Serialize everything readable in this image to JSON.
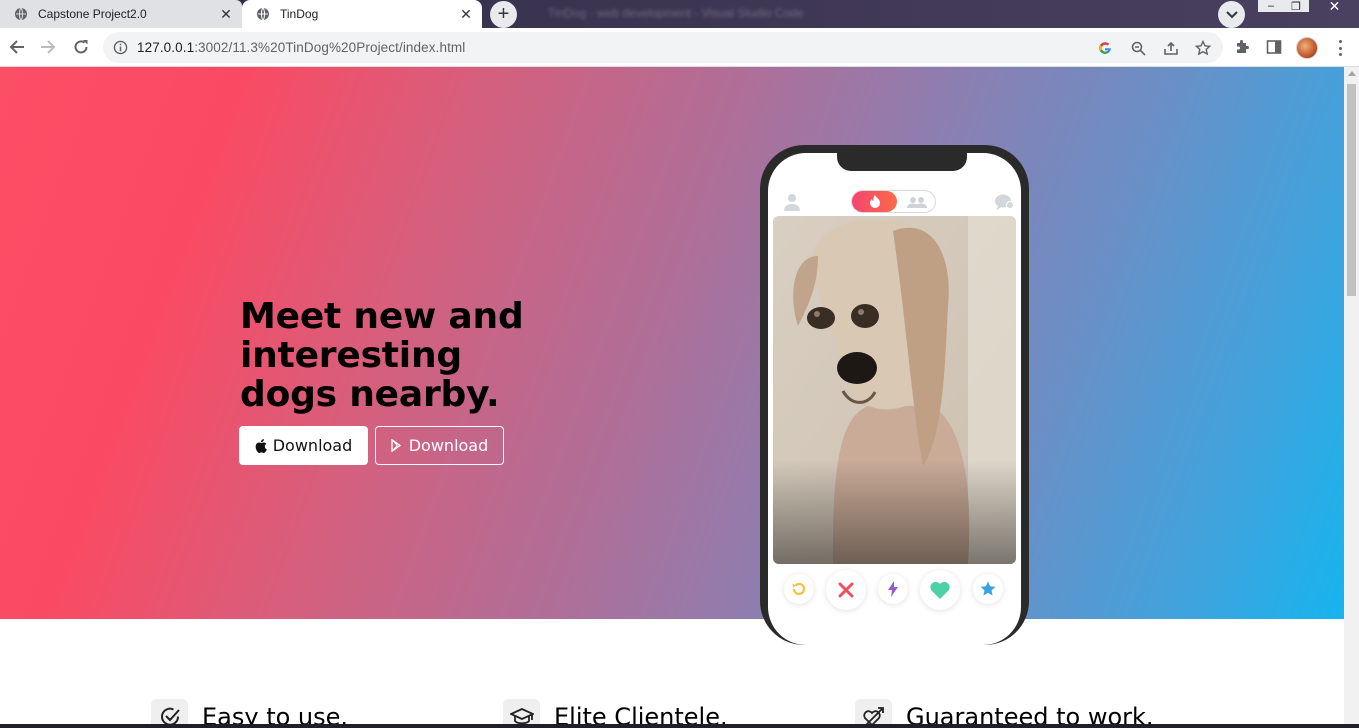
{
  "browser": {
    "tabs": [
      {
        "title": "Capstone Project2.0",
        "active": false
      },
      {
        "title": "TinDog",
        "active": true
      }
    ],
    "background_window_title": "TinDog - web development - Visual Studio Code",
    "url_host": "127.0.0.1",
    "url_rest": ":3002/11.3%20TinDog%20Project/index.html"
  },
  "hero": {
    "headline": "Meet new and interesting dogs nearby.",
    "buttons": [
      {
        "label": "Download",
        "icon": "apple-icon",
        "style": "dark"
      },
      {
        "label": "Download",
        "icon": "google-play-icon",
        "style": "outline"
      }
    ],
    "gradient_colors": [
      "#fb4f66",
      "#16b4ee"
    ]
  },
  "phone_app": {
    "actions": [
      "rewind-icon",
      "nope-icon",
      "boost-icon",
      "like-icon",
      "superlike-icon"
    ],
    "action_colors": {
      "rewind": "#f5c342",
      "nope": "#f04e5e",
      "boost": "#9b59d0",
      "like": "#4fd1a6",
      "superlike": "#3aa3e3"
    }
  },
  "features": [
    {
      "title": "Easy to use.",
      "icon": "check-circle-icon"
    },
    {
      "title": "Elite Clientele.",
      "icon": "graduation-cap-icon"
    },
    {
      "title": "Guaranteed to work.",
      "icon": "heart-arrow-icon"
    }
  ]
}
